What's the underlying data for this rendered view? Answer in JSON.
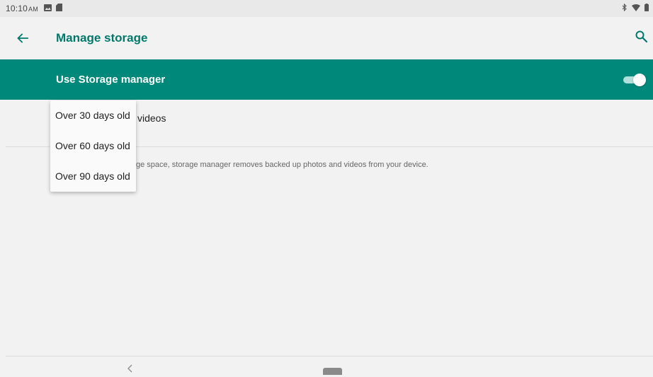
{
  "status_bar": {
    "time": "10:10",
    "ampm": "AM",
    "icons_left": [
      "image-notification-icon",
      "sd-card-icon"
    ],
    "icons_right": [
      "bluetooth-icon",
      "wifi-icon",
      "battery-icon"
    ]
  },
  "toolbar": {
    "title": "Manage storage",
    "back_icon": "arrow-back-icon",
    "search_icon": "search-icon"
  },
  "master_switch": {
    "label": "Use Storage manager",
    "checked": true
  },
  "preference": {
    "title_visible_fragment": "videos",
    "summary_visible_fragment": "ge space, storage manager removes backed up photos and videos from your device."
  },
  "dropdown": {
    "options": [
      "Over 30 days old",
      "Over 60 days old",
      "Over 90 days old"
    ]
  },
  "colors": {
    "accent": "#00796b",
    "switch_bar": "#00897b",
    "background": "#f2f2f2"
  }
}
